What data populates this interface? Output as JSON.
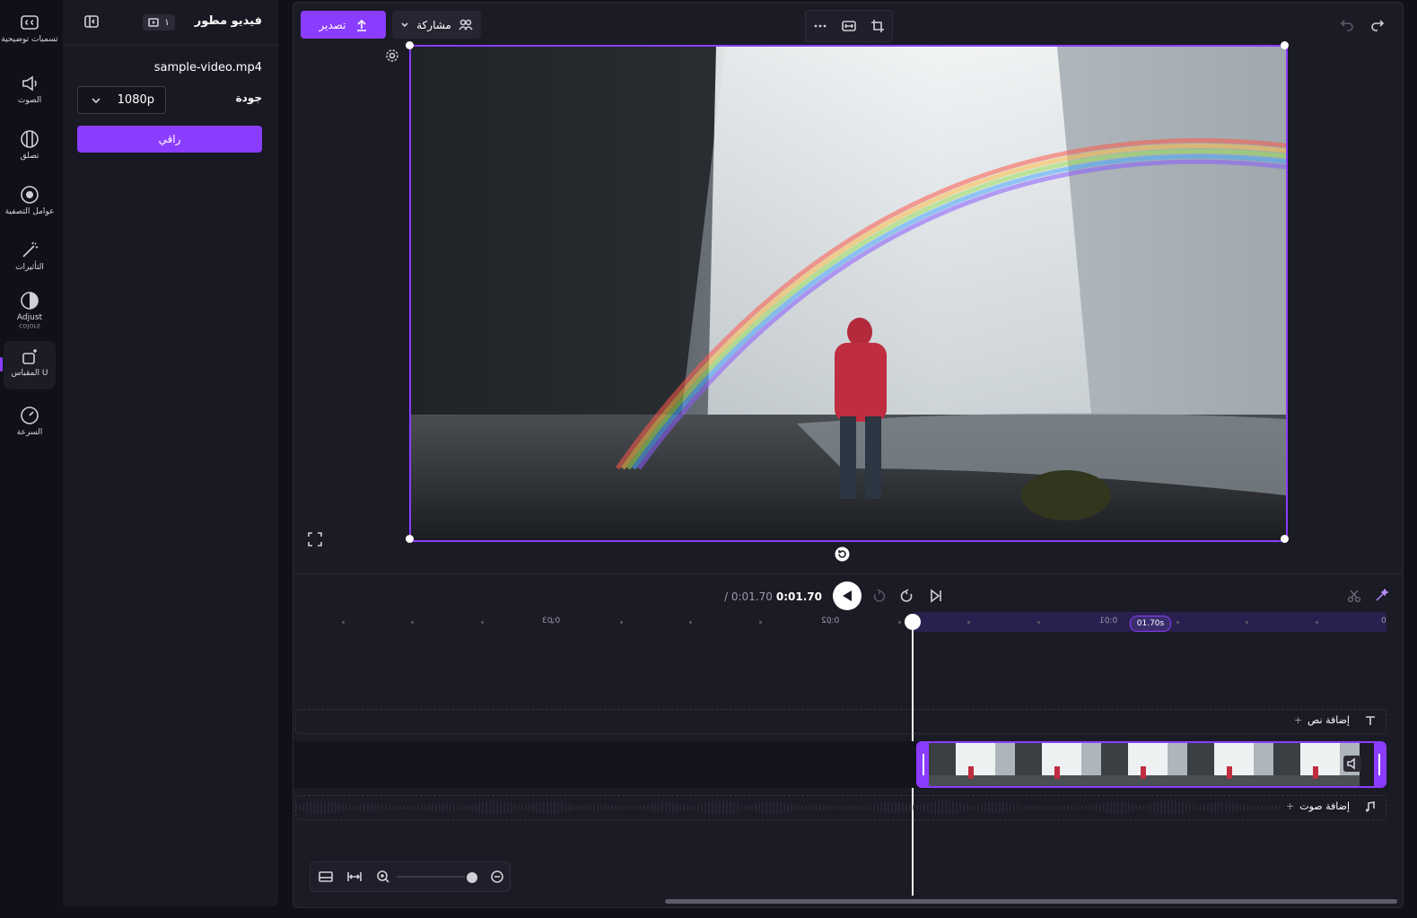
{
  "app": {
    "title": "فيديو مطور"
  },
  "rail": {
    "items": [
      {
        "label": "تسميات توضيحية",
        "icon": "captions-icon"
      },
      {
        "label": "الصوت",
        "icon": "audio-icon"
      },
      {
        "label": "تصلق",
        "icon": "fade-icon"
      },
      {
        "label": "عوامل التصفية",
        "icon": "filters-icon"
      },
      {
        "label": "التأثيرات",
        "icon": "effects-icon"
      },
      {
        "label": "Adjust",
        "sub": "colors",
        "icon": "adjust-colors-icon"
      },
      {
        "label": "المقياس U",
        "icon": "scale-icon"
      },
      {
        "label": "السرعة",
        "icon": "speed-icon"
      }
    ],
    "active_index": 6
  },
  "panel": {
    "badge": "١",
    "file_name": "sample-video.mp4",
    "quality_label": "جودة",
    "quality_value": "1080p",
    "confirm_label": "راقي"
  },
  "toolbar": {
    "export_label": "تصدير",
    "share_label": "مشاركة"
  },
  "timeline": {
    "current_time": "0:01.70",
    "total_time": "/ 0:01.70",
    "pill_time": "01.70s",
    "ruler_labels": [
      "0",
      "0:01",
      "0:02",
      "0:03"
    ],
    "add_text_label": "إضافة نص",
    "add_audio_label": "إضافة صوت",
    "zoom_level": 0.9
  },
  "colors": {
    "accent": "#8b3dff",
    "background": "#101018",
    "panel": "#191924"
  }
}
